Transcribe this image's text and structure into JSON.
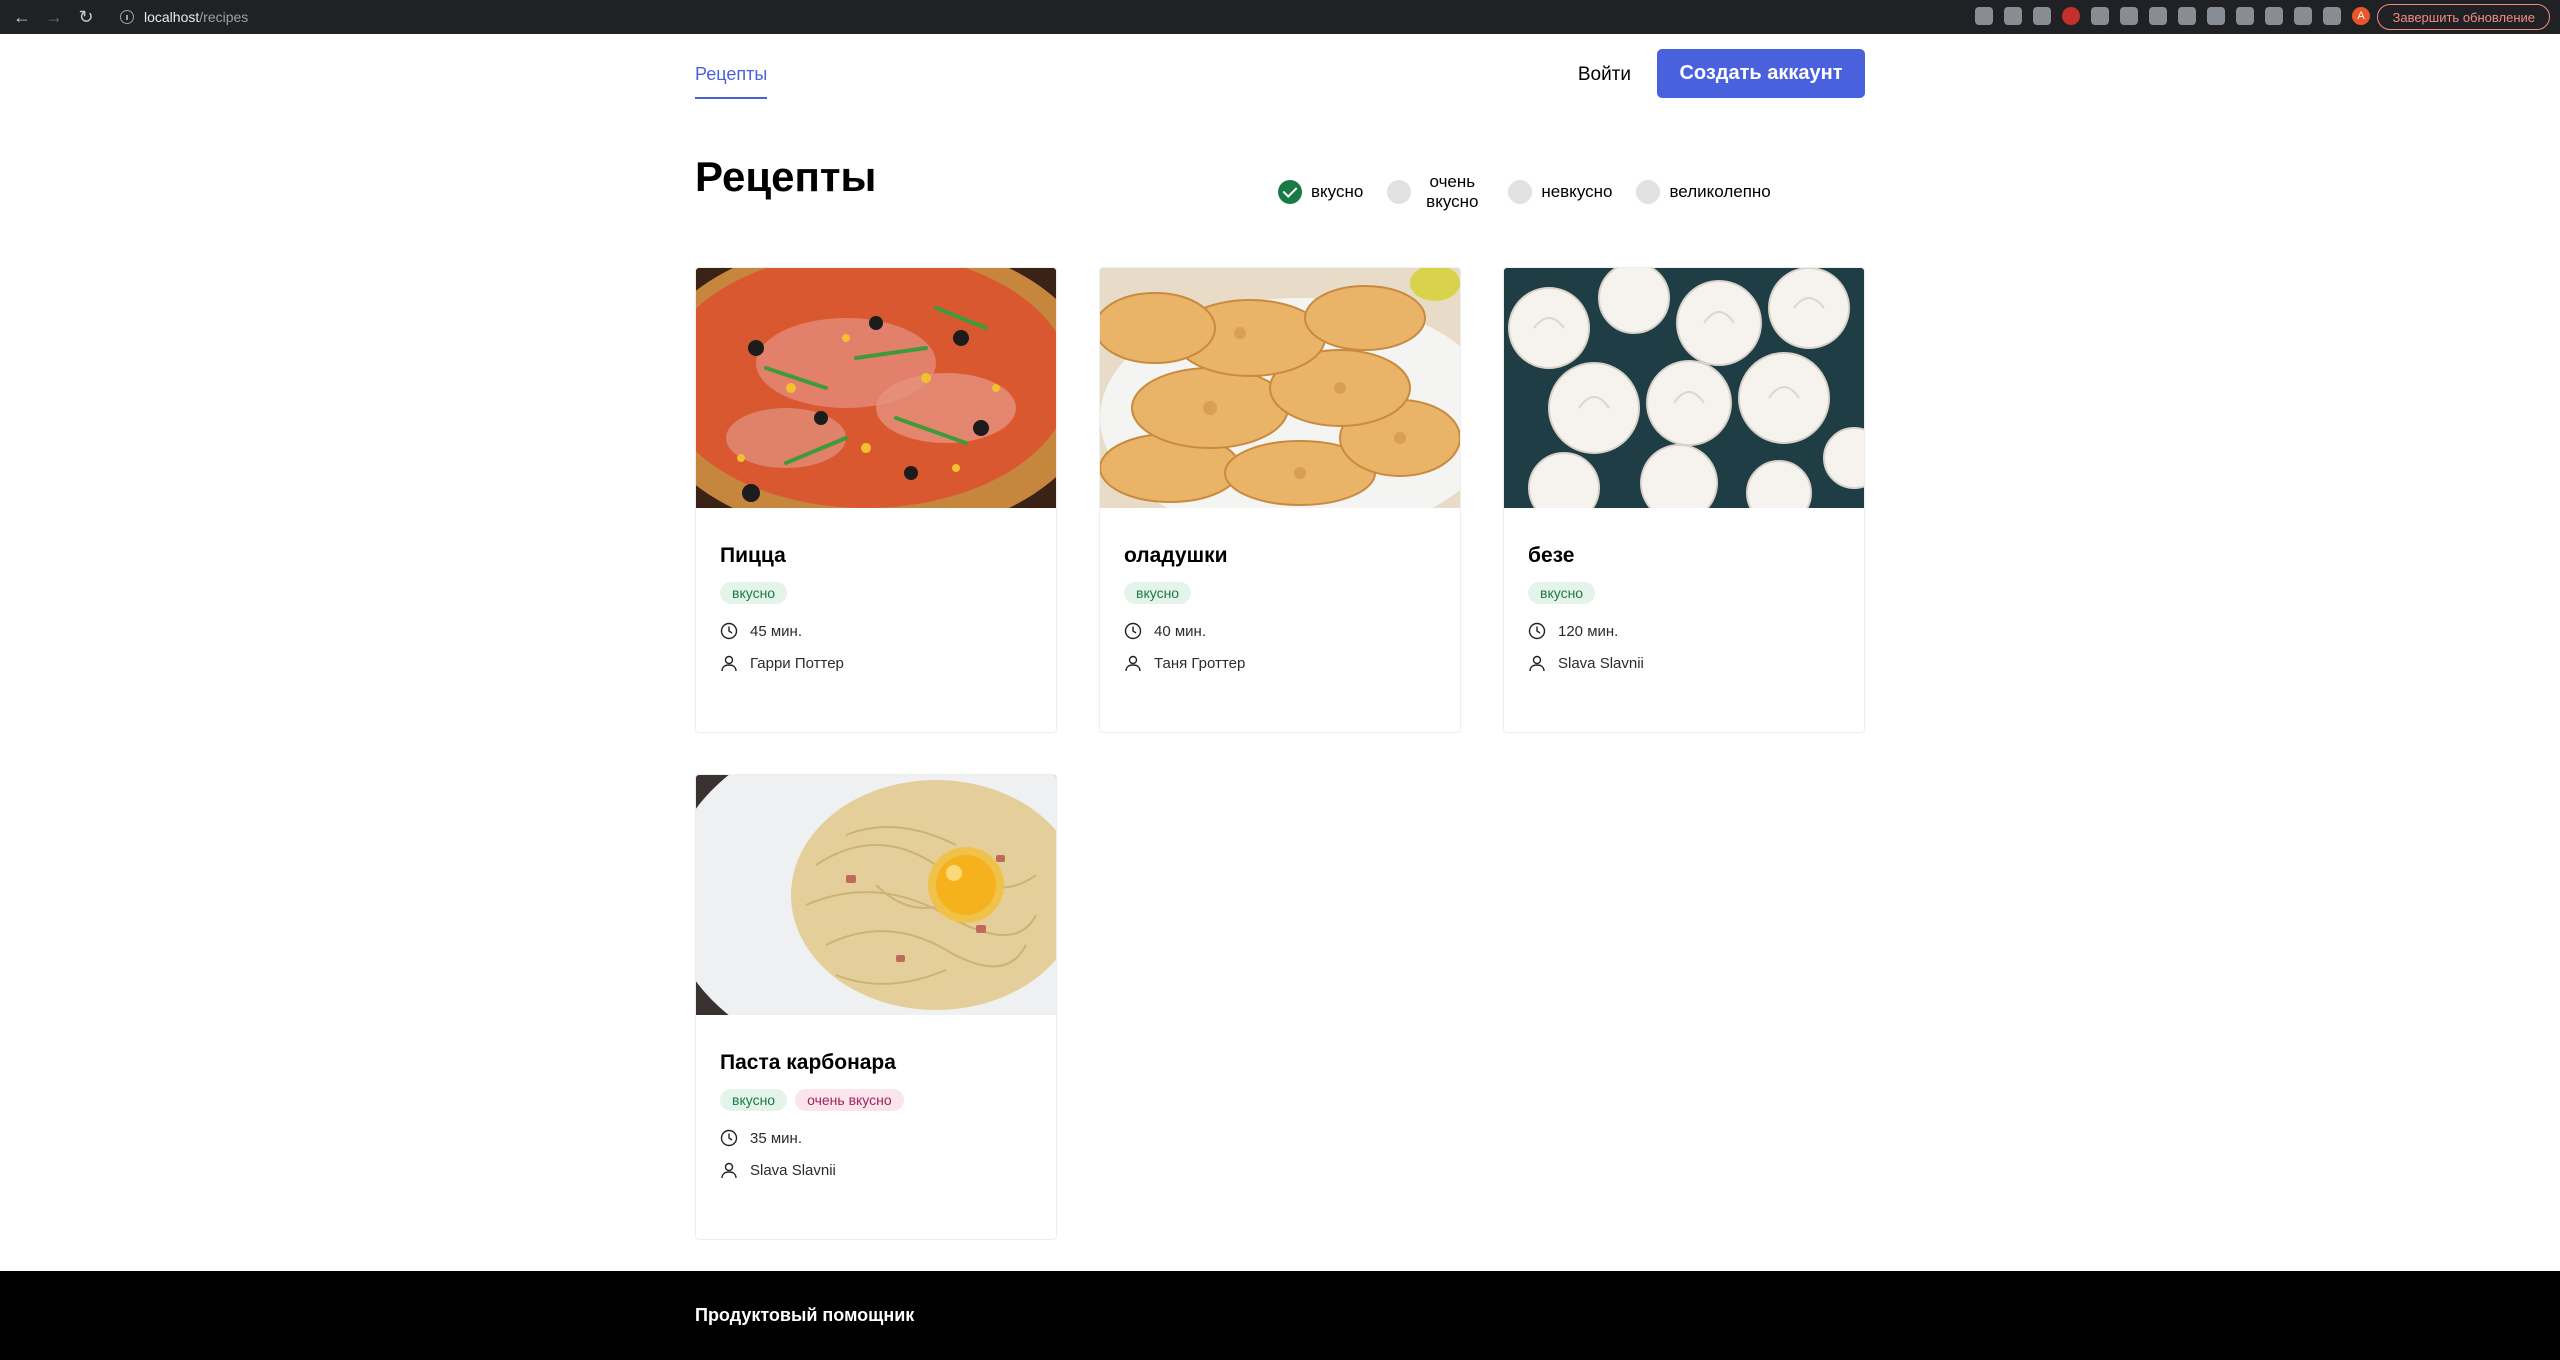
{
  "browser": {
    "url_host": "localhost",
    "url_path": "/recipes",
    "update_label": "Завершить обновление",
    "profile_initial": "A"
  },
  "header": {
    "nav_recipes": "Рецепты",
    "login": "Войти",
    "signup": "Создать аккаунт"
  },
  "page": {
    "title": "Рецепты"
  },
  "filters": [
    {
      "label": "вкусно",
      "checked": true
    },
    {
      "label_line1": "очень",
      "label_line2": "вкусно",
      "checked": false
    },
    {
      "label": "невкусно",
      "checked": false
    },
    {
      "label": "великолепно",
      "checked": false
    }
  ],
  "recipes": [
    {
      "name": "Пицца",
      "tags": [
        "вкусно"
      ],
      "time": "45 мин.",
      "author": "Гарри Поттер",
      "image": "pizza-photo"
    },
    {
      "name": "оладушки",
      "tags": [
        "вкусно"
      ],
      "time": "40 мин.",
      "author": "Таня Гроттер",
      "image": "pancakes-photo"
    },
    {
      "name": "безе",
      "tags": [
        "вкусно"
      ],
      "time": "120 мин.",
      "author": "Slava Slavnii",
      "image": "meringue-photo"
    },
    {
      "name": "Паста карбонара",
      "tags": [
        "вкусно",
        "очень вкусно"
      ],
      "time": "35 мин.",
      "author": "Slava Slavnii",
      "image": "carbonara-photo"
    }
  ],
  "footer": {
    "brand": "Продуктовый помощник"
  },
  "colors": {
    "accent": "#4a61dd",
    "tag_green_bg": "#e5f4ea",
    "tag_green_text": "#1a7a46",
    "tag_pink_bg": "#fbe4ec",
    "tag_pink_text": "#a0245a",
    "footer_bg": "#000000"
  }
}
